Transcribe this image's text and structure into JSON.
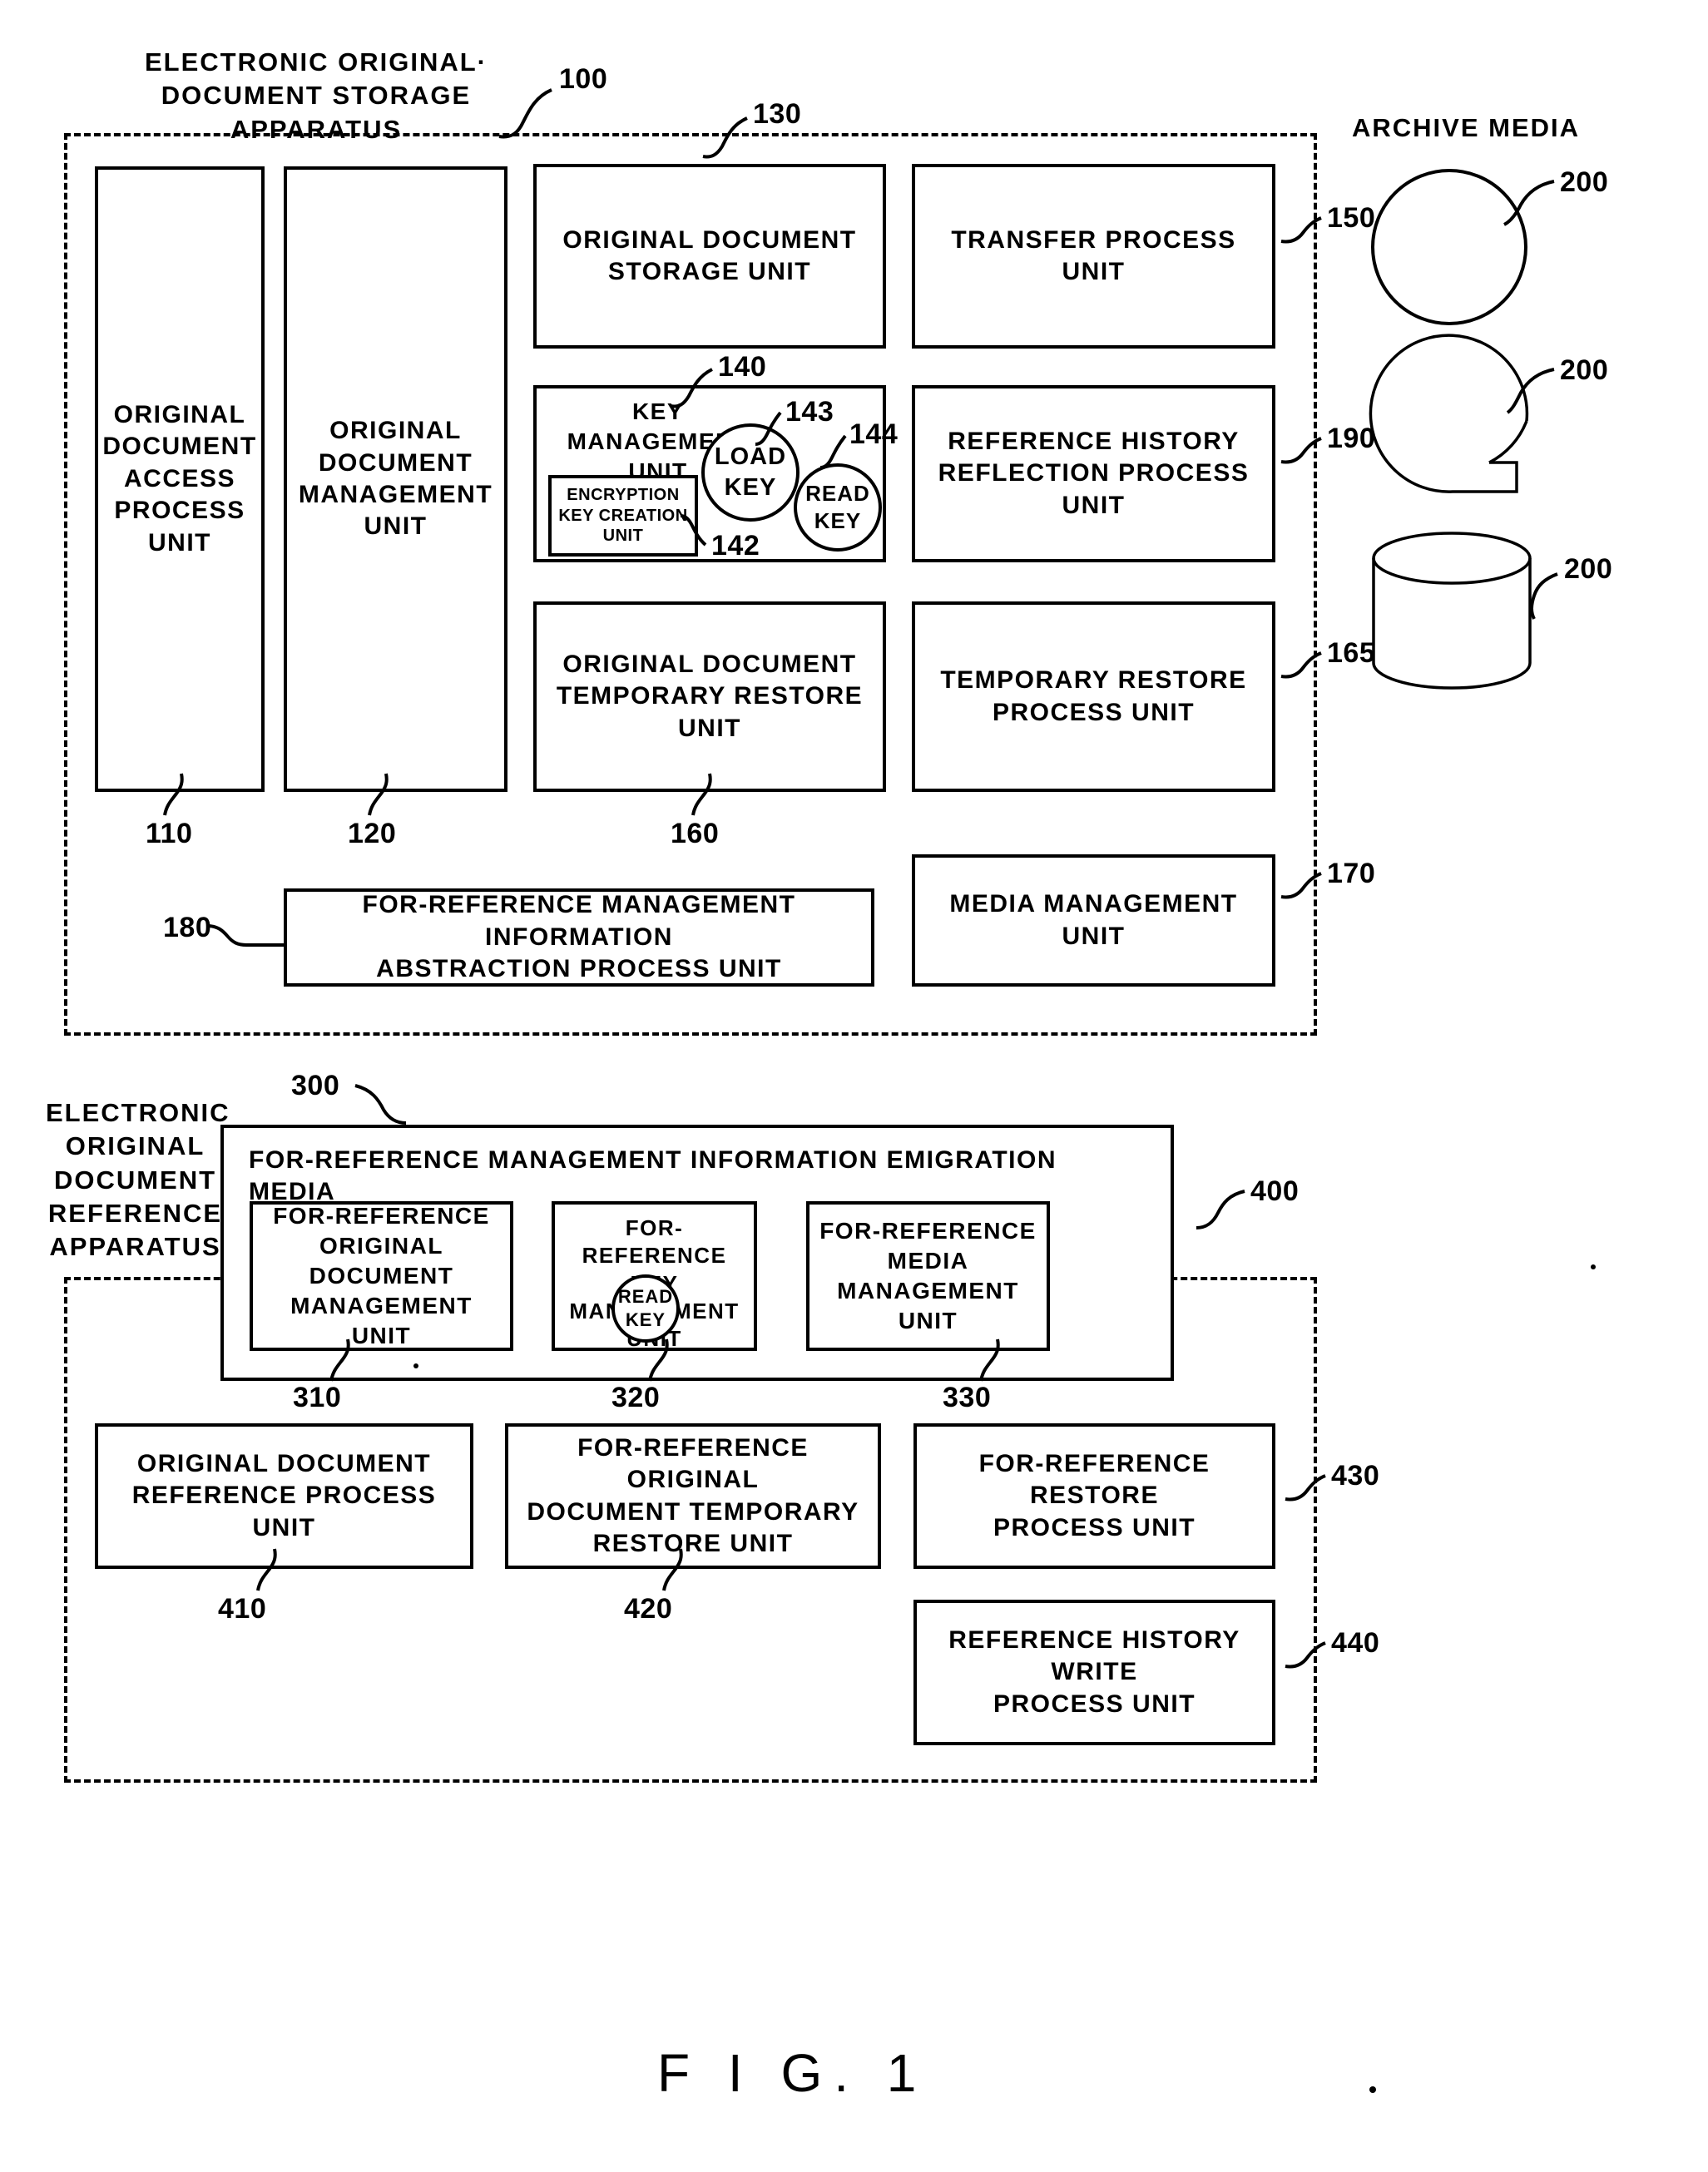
{
  "figure": {
    "caption": "F I G.  1"
  },
  "storage_apparatus": {
    "title": "ELECTRONIC ORIGINAL·\nDOCUMENT STORAGE APPARATUS",
    "ref": "100",
    "units": {
      "access_process": {
        "label": "ORIGINAL\nDOCUMENT\nACCESS\nPROCESS\nUNIT",
        "ref": "110"
      },
      "document_management": {
        "label": "ORIGINAL\nDOCUMENT\nMANAGEMENT\nUNIT",
        "ref": "120"
      },
      "document_storage": {
        "label": "ORIGINAL DOCUMENT\nSTORAGE UNIT",
        "ref": "130"
      },
      "key_management": {
        "label": "KEY MANAGEMENT\nUNIT",
        "ref": "140"
      },
      "encryption_key_creation": {
        "label": "ENCRYPTION\nKEY CREATION\nUNIT",
        "ref": "142"
      },
      "load_key": {
        "label": "LOAD\nKEY",
        "ref": "143"
      },
      "read_key": {
        "label": "READ\nKEY",
        "ref": "144"
      },
      "temporary_restore": {
        "label": "ORIGINAL DOCUMENT\nTEMPORARY RESTORE\nUNIT",
        "ref": "160"
      },
      "transfer_process": {
        "label": "TRANSFER PROCESS UNIT",
        "ref": "150"
      },
      "reference_history_reflection": {
        "label": "REFERENCE HISTORY\nREFLECTION PROCESS\nUNIT",
        "ref": "190"
      },
      "temporary_restore_process": {
        "label": "TEMPORARY RESTORE\nPROCESS UNIT",
        "ref": "165"
      },
      "media_management": {
        "label": "MEDIA MANAGEMENT UNIT",
        "ref": "170"
      },
      "abstraction_process": {
        "label": "FOR-REFERENCE MANAGEMENT INFORMATION\nABSTRACTION PROCESS UNIT",
        "ref": "180"
      }
    }
  },
  "archive_media": {
    "title": "ARCHIVE MEDIA",
    "items": [
      {
        "icon": "optical-disc-icon",
        "ref": "200"
      },
      {
        "icon": "tape-reel-icon",
        "ref": "200"
      },
      {
        "icon": "database-cylinder-icon",
        "ref": "200"
      }
    ]
  },
  "reference_apparatus": {
    "title": "ELECTRONIC\nORIGINAL\nDOCUMENT\nREFERENCE\nAPPARATUS",
    "ref": "400",
    "emigration_media": {
      "label": "FOR-REFERENCE MANAGEMENT INFORMATION EMIGRATION MEDIA",
      "ref": "300",
      "units": {
        "doc_management": {
          "label": "FOR-REFERENCE\nORIGINAL\nDOCUMENT\nMANAGEMENT UNIT",
          "ref": "310"
        },
        "key_management": {
          "label": "FOR-REFERENCE KEY\nMANAGEMENT UNIT",
          "ref": "320"
        },
        "read_key": {
          "label": "READ\nKEY"
        },
        "media_management": {
          "label": "FOR-REFERENCE\nMEDIA MANAGEMENT\nUNIT",
          "ref": "330"
        }
      }
    },
    "units": {
      "reference_process": {
        "label": "ORIGINAL DOCUMENT\nREFERENCE PROCESS UNIT",
        "ref": "410"
      },
      "temporary_restore": {
        "label": "FOR-REFERENCE ORIGINAL\nDOCUMENT TEMPORARY\nRESTORE UNIT",
        "ref": "420"
      },
      "restore_process": {
        "label": "FOR-REFERENCE RESTORE\nPROCESS UNIT",
        "ref": "430"
      },
      "history_write": {
        "label": "REFERENCE HISTORY WRITE\nPROCESS UNIT",
        "ref": "440"
      }
    }
  }
}
